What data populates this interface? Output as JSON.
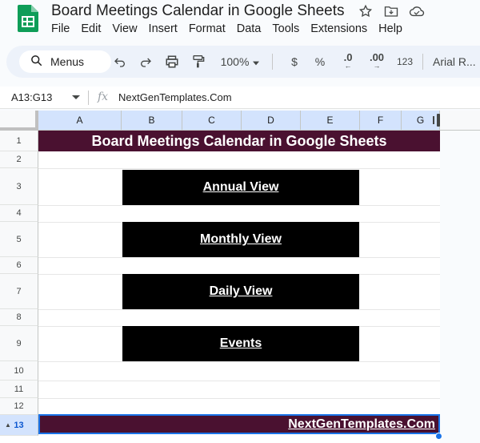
{
  "app": {
    "doc_title": "Board Meetings Calendar in Google Sheets",
    "title_icons": [
      "star-icon",
      "move-to-folder-icon",
      "cloud-saved-icon"
    ],
    "menu": [
      "File",
      "Edit",
      "View",
      "Insert",
      "Format",
      "Data",
      "Tools",
      "Extensions",
      "Help"
    ]
  },
  "toolbar": {
    "search_label": "Menus",
    "zoom": "100%",
    "currency": "$",
    "percent": "%",
    "decrease_decimal": ".0",
    "increase_decimal": ".00",
    "number_format": "123",
    "font": "Arial R..."
  },
  "formula_bar": {
    "name_box": "A13:G13",
    "fx": "fx",
    "content": "NextGenTemplates.Com"
  },
  "columns": [
    "A",
    "B",
    "C",
    "D",
    "E",
    "F",
    "G"
  ],
  "rows": [
    "1",
    "2",
    "3",
    "4",
    "5",
    "6",
    "7",
    "8",
    "9",
    "10",
    "11",
    "12",
    "13"
  ],
  "sheet": {
    "title": "Board Meetings Calendar in Google Sheets",
    "buttons": [
      "Annual View",
      "Monthly View",
      "Daily View",
      "Events"
    ],
    "footer": "NextGenTemplates.Com"
  },
  "colors": {
    "banner": "#4a1130",
    "button": "#000000",
    "selection": "#1a73e8",
    "header_selected": "#d3e3fd"
  }
}
